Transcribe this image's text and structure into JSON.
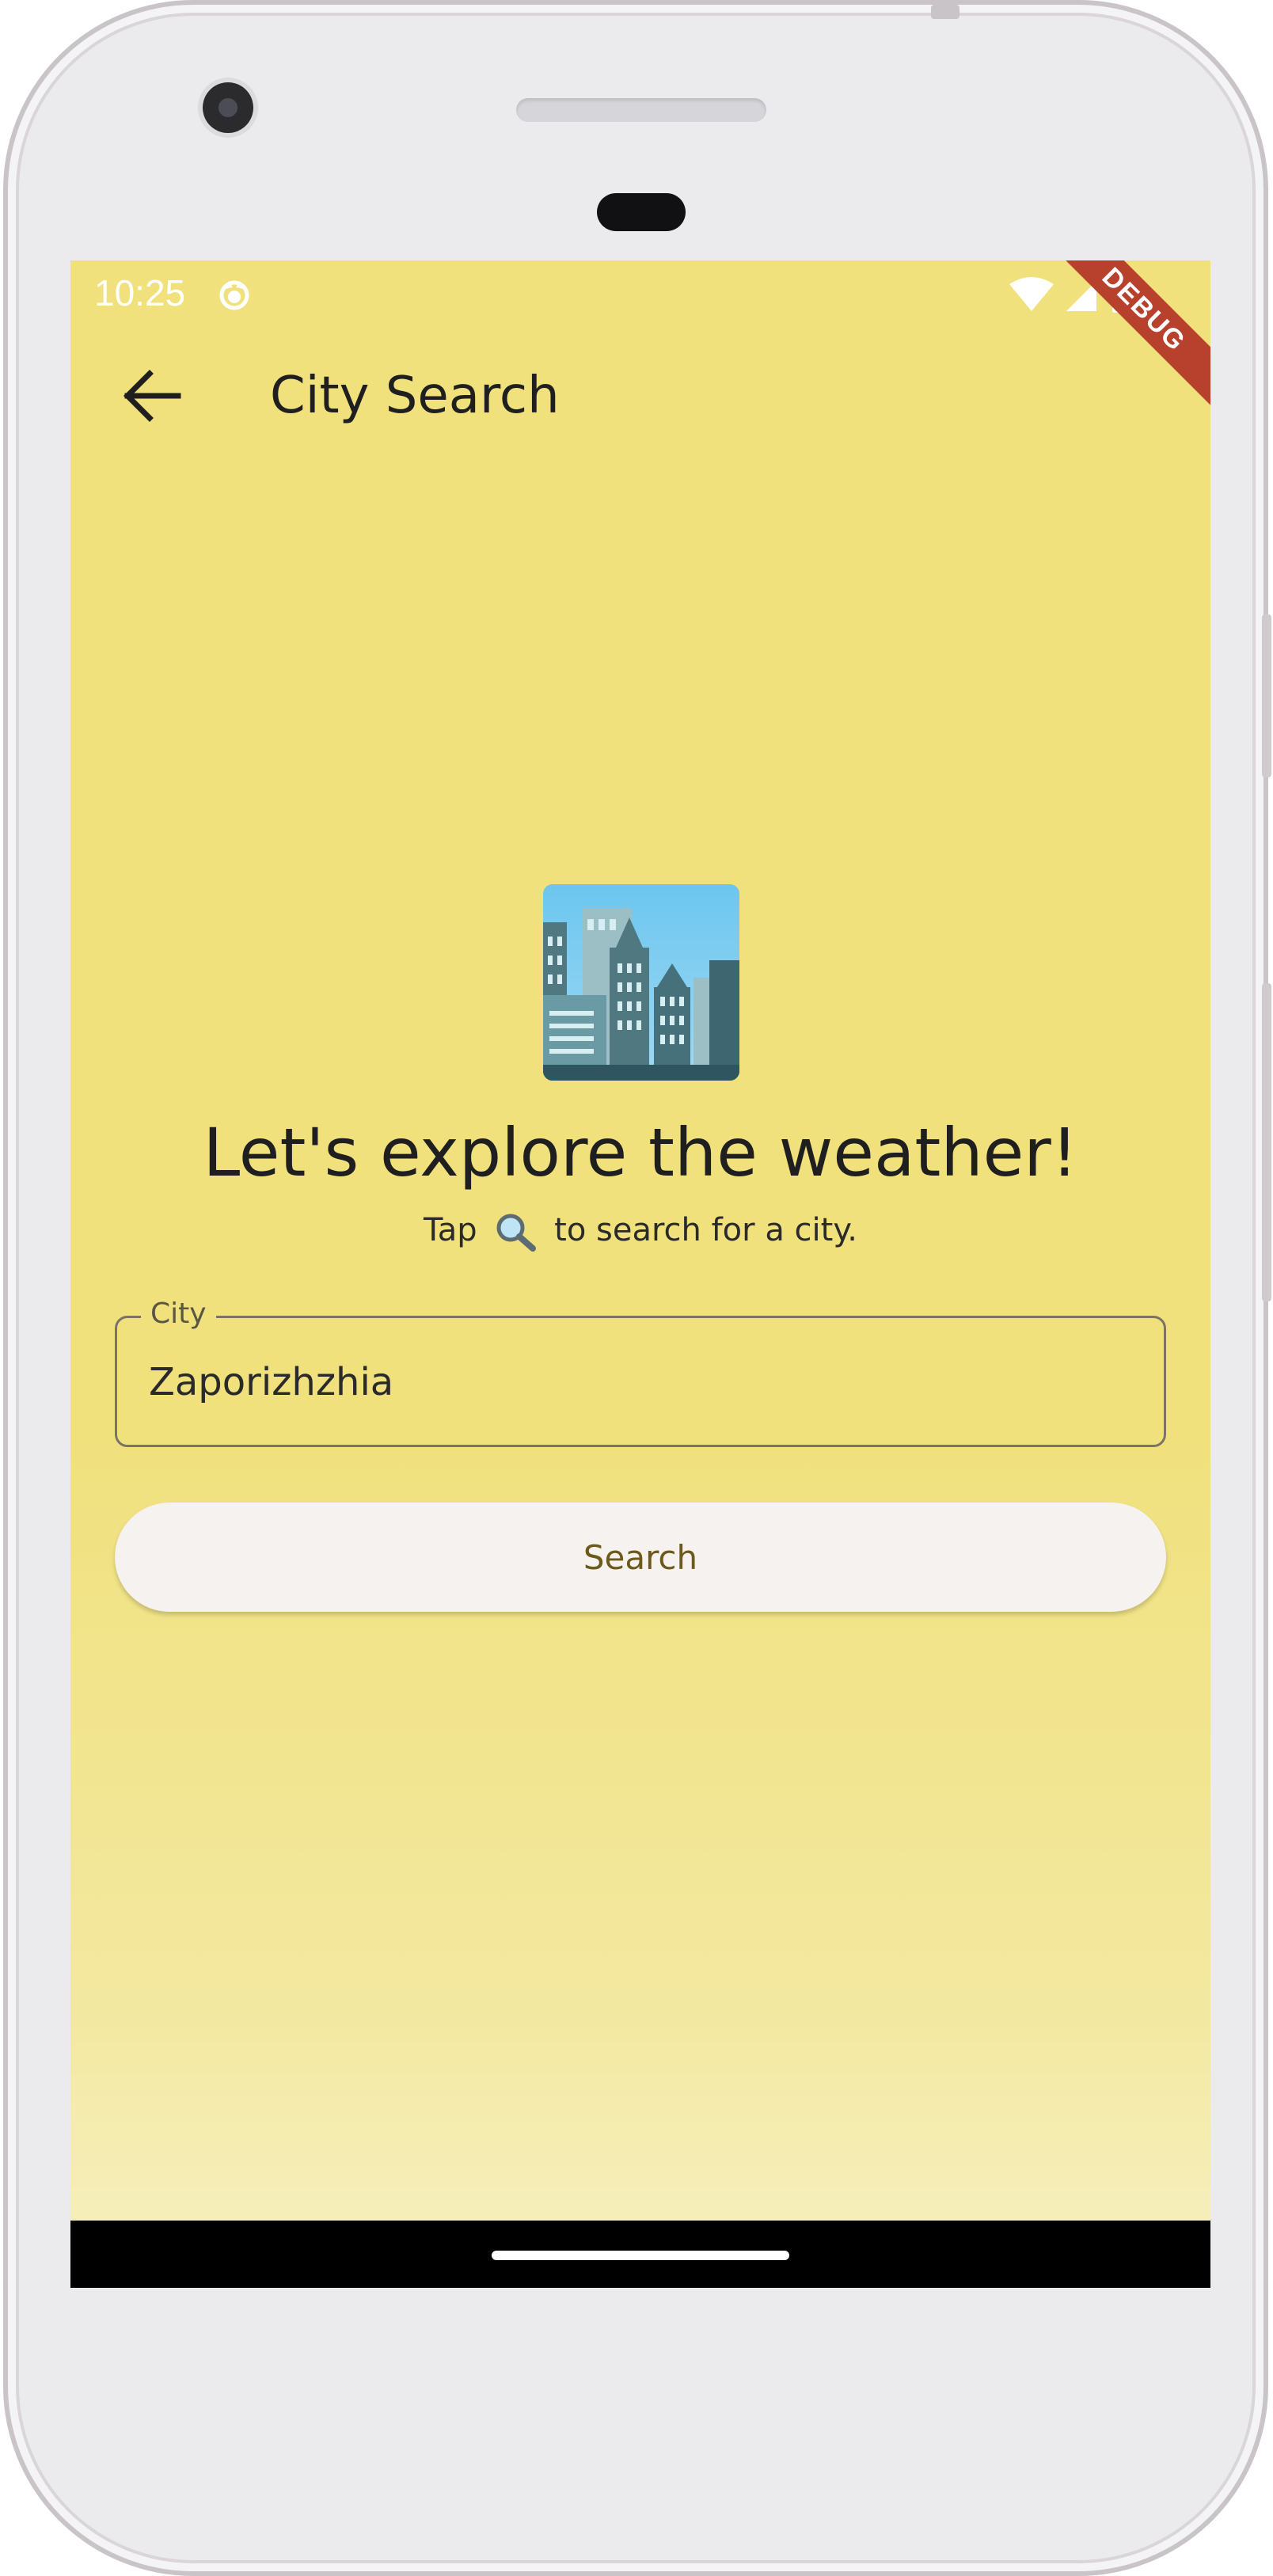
{
  "status_bar": {
    "time": "10:25",
    "debug_label": "DEBUG"
  },
  "app_bar": {
    "title": "City Search"
  },
  "hero": {
    "icon": "cityscape-icon",
    "headline": "Let's explore the weather!",
    "subline_before": "Tap",
    "subline_icon": "magnifier-icon",
    "subline_after": "to search for a city."
  },
  "city_field": {
    "label": "City",
    "value": "Zaporizhzhia"
  },
  "search_button": {
    "label": "Search"
  },
  "colors": {
    "background": "#f0e17d",
    "button_text": "#6b5a1c",
    "debug_banner": "#b8412d"
  }
}
